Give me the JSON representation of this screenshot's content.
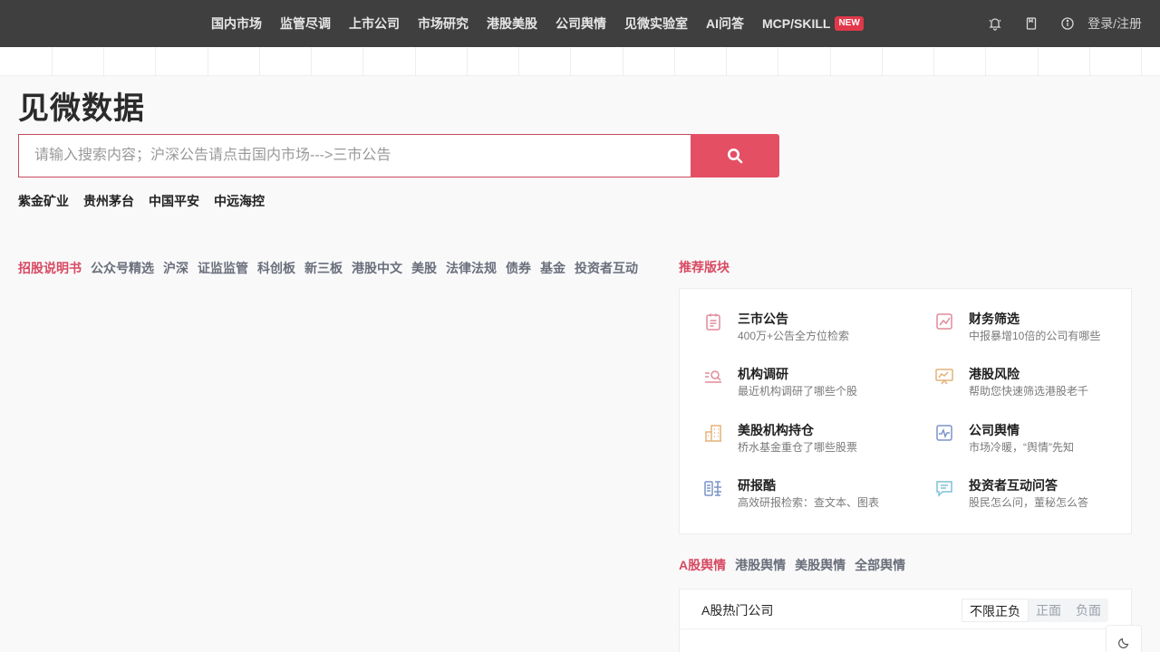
{
  "nav": {
    "items": [
      "国内市场",
      "监管尽调",
      "上市公司",
      "市场研究",
      "港股美股",
      "公司舆情",
      "见微实验室",
      "AI问答"
    ],
    "mcp_label": "MCP/SKILL",
    "new_badge": "NEW",
    "login": "登录/注册"
  },
  "logo": "见微数据",
  "search": {
    "placeholder": "请输入搜索内容；沪深公告请点击国内市场--->三市公告"
  },
  "hot_companies": [
    "紫金矿业",
    "贵州茅台",
    "中国平安",
    "中远海控"
  ],
  "left_tabs": [
    "招股说明书",
    "公众号精选",
    "沪深",
    "证监监管",
    "科创板",
    "新三板",
    "港股中文",
    "美股",
    "法律法规",
    "债券",
    "基金",
    "投资者互动"
  ],
  "recommend": {
    "title": "推荐版块",
    "items": [
      {
        "title": "三市公告",
        "desc": "400万+公告全方位检索",
        "icon": "announcement-icon"
      },
      {
        "title": "财务筛选",
        "desc": "中报暴增10倍的公司有哪些",
        "icon": "chart-trend-icon"
      },
      {
        "title": "机构调研",
        "desc": "最近机构调研了哪些个股",
        "icon": "research-search-icon"
      },
      {
        "title": "港股风险",
        "desc": "帮助您快速筛选港股老千",
        "icon": "board-chart-icon"
      },
      {
        "title": "美股机构持仓",
        "desc": "桥水基金重仓了哪些股票",
        "icon": "building-icon"
      },
      {
        "title": "公司舆情",
        "desc": "市场冷暖，“舆情”先知",
        "icon": "pulse-icon"
      },
      {
        "title": "研报酷",
        "desc": "高效研报检索：查文本、图表",
        "icon": "report-icon"
      },
      {
        "title": "投资者互动问答",
        "desc": "股民怎么问，董秘怎么答",
        "icon": "chat-icon"
      }
    ]
  },
  "sentiment_tabs": [
    "A股舆情",
    "港股舆情",
    "美股舆情",
    "全部舆情"
  ],
  "hot_card": {
    "title": "A股热门公司",
    "segments": [
      "不限正负",
      "正面",
      "负面"
    ]
  },
  "colors": {
    "accent": "#e44f64",
    "nav_bg": "#3f3f3f",
    "page_bg": "#f9f9fa"
  }
}
